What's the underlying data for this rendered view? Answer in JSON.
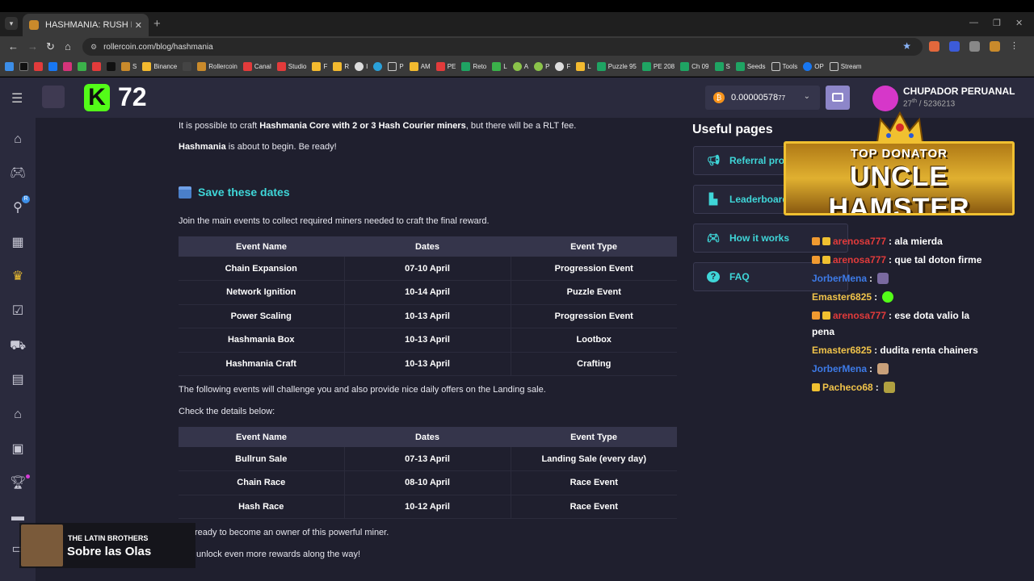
{
  "browser": {
    "tab_title": "HASHMANIA: RUSH NOW!",
    "url": "rollercoin.com/blog/hashmania",
    "bookmarks": [
      "S",
      "Binance",
      "Rollercoin",
      "Canal",
      "Studio",
      "F",
      "R",
      "I",
      "P",
      "AM",
      "PE",
      "Reto",
      "L",
      "A",
      "P",
      "F",
      "L",
      "Puzzle 95",
      "PE 208",
      "Ch 09",
      "S",
      "Seeds",
      "Tools",
      "OP",
      "Stream"
    ]
  },
  "site": {
    "kick_count": "72",
    "balance": "0.00000578",
    "balance_small": "77",
    "username": "CHUPADOR PERUANAL",
    "rank_num": "27",
    "rank_sup": "th",
    "rank_rest": " / 5236213"
  },
  "article": {
    "p1_pre": "It is possible to craft ",
    "p1_bold": "Hashmania Core with 2 or 3 Hash Courier miners",
    "p1_post": ", but there will be a RLT fee.",
    "p2_bold": "Hashmania",
    "p2_post": " is about to begin. Be ready!",
    "section_title": "Save these dates",
    "p3": "Join the main events to collect required miners needed to craft the final reward.",
    "table_headers": [
      "Event Name",
      "Dates",
      "Event Type"
    ],
    "table1": [
      [
        "Chain Expansion",
        "07-10 April",
        "Progression Event"
      ],
      [
        "Network Ignition",
        "10-14 April",
        "Puzzle Event"
      ],
      [
        "Power Scaling",
        "10-13 April",
        "Progression Event"
      ],
      [
        "Hashmania Box",
        "10-13 April",
        "Lootbox"
      ],
      [
        "Hashmania Craft",
        "10-13 April",
        "Crafting"
      ]
    ],
    "p4": "The following events will challenge you and also provide nice daily offers on the Landing sale.",
    "p5": "Check the details below:",
    "table2": [
      [
        "Bullrun Sale",
        "07-13 April",
        "Landing Sale (every day)"
      ],
      [
        "Chain Race",
        "08-10 April",
        "Race Event"
      ],
      [
        "Hash Race",
        "10-12 April",
        "Race Event"
      ]
    ],
    "p6": "ready to become an owner of this powerful miner.",
    "p7": "unlock even more rewards along the way!"
  },
  "useful": {
    "title": "Useful pages",
    "links": [
      "Referral program",
      "Leaderboard",
      "How it works",
      "FAQ"
    ]
  },
  "overlay": {
    "donator_line1": "TOP DONATOR",
    "donator_line2": "UNCLE HAMSTER",
    "chat": [
      {
        "nick": "arenosa777",
        "msg": " : ala mierda"
      },
      {
        "nick": "arenosa777",
        "msg": " : que tal doton firme"
      },
      {
        "nick": "JorberMena",
        "msg": " :"
      },
      {
        "nick": "Emaster6825",
        "msg": " :"
      },
      {
        "nick": "arenosa777",
        "msg": " : ese dota valio la"
      },
      {
        "nick": "",
        "msg": "pena"
      },
      {
        "nick": "Emaster6825",
        "msg": " : dudita renta chainers"
      },
      {
        "nick": "JorberMena",
        "msg": " :"
      },
      {
        "nick": "Pacheco68",
        "msg": " :"
      }
    ],
    "brothers_line1": "THE LATIN BROTHERS",
    "brothers_line2": "Sobre las Olas"
  }
}
